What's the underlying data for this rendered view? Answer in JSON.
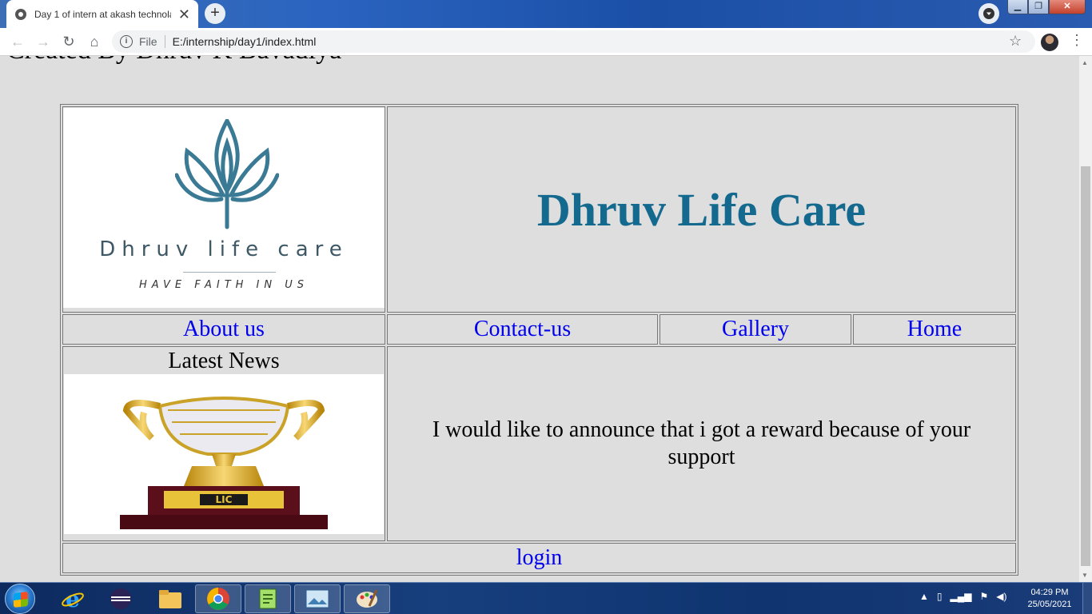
{
  "browser": {
    "tab_title": "Day 1 of intern at akash technola",
    "tab_close": "✕",
    "new_tab": "+",
    "address_scheme": "File",
    "address_url": "E:/internship/day1/index.html",
    "info_icon": "i",
    "back": "←",
    "forward": "→",
    "reload": "↻",
    "home": "⌂",
    "star": "☆",
    "menu": "⋮"
  },
  "window": {
    "minimize": "▁",
    "maximize": "❐",
    "close": "✕"
  },
  "page": {
    "credit": "Created By Dhruv K Bavadiya",
    "logo": {
      "name": "Dhruv life care",
      "tagline": "HAVE FAITH IN US",
      "color": "#3a7a94"
    },
    "brand_title": "Dhruv Life Care",
    "brand_color": "#14698f",
    "nav": [
      "About us",
      "Contact-us",
      "Gallery",
      "Home"
    ],
    "news_title": "Latest News",
    "trophy": {
      "banner": "DIMONDIATE TROPHY - 2014",
      "label": "LIC"
    },
    "announcement": "I would like to announce that i got a reward because of your support",
    "login": "login",
    "link_color": "#0000ee"
  },
  "taskbar": {
    "items": [
      "start-orb",
      "internet-explorer",
      "eclipse",
      "file-explorer",
      "chrome",
      "notepad-plus-plus",
      "photo-viewer",
      "paint"
    ],
    "tray_icons": [
      "show-hidden-icon",
      "battery-icon",
      "signal-icon",
      "flag-icon",
      "volume-icon"
    ],
    "time": "04:29 PM",
    "date": "25/05/2021"
  }
}
